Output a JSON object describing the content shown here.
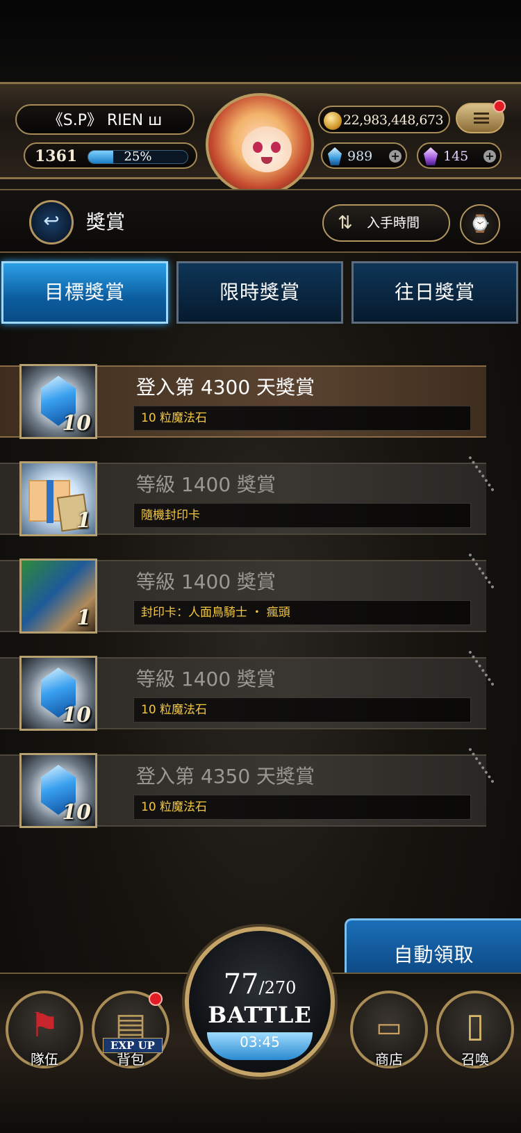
{
  "player": {
    "name": "《S.P》 RIEN ꟺ",
    "level": "1361",
    "exp_percent": "25%",
    "coins": "22,983,448,673",
    "blue_gems": "989",
    "purple_gems": "145"
  },
  "titlebar": {
    "title": "獎賞",
    "sort_label": "入手時間"
  },
  "tabs": [
    {
      "label": "目標獎賞",
      "active": true
    },
    {
      "label": "限時獎賞",
      "active": false
    },
    {
      "label": "往日獎賞",
      "active": false
    }
  ],
  "rewards": [
    {
      "title": "登入第 4300 天獎賞",
      "subtitle": "10 粒魔法石",
      "count": "10",
      "icon": "magic-stone-icon",
      "locked": false
    },
    {
      "title": "等級 1400 獎賞",
      "subtitle": "隨機封印卡",
      "count": "1",
      "icon": "gift-box-icon",
      "locked": true
    },
    {
      "title": "等級 1400 獎賞",
      "subtitle": "封印卡：人面鳥騎士 ・ 瘋頭",
      "count": "1",
      "icon": "card-portrait-icon",
      "locked": true
    },
    {
      "title": "等級 1400 獎賞",
      "subtitle": "10 粒魔法石",
      "count": "10",
      "icon": "magic-stone-icon",
      "locked": true
    },
    {
      "title": "登入第 4350 天獎賞",
      "subtitle": "10 粒魔法石",
      "count": "10",
      "icon": "magic-stone-icon",
      "locked": true
    }
  ],
  "auto_claim": "自動領取",
  "nav": {
    "team": "隊伍",
    "bag": "背包",
    "bag_badge": "EXP UP",
    "shop": "商店",
    "summon": "召喚"
  },
  "battle": {
    "stamina_current": "77",
    "stamina_max": "/270",
    "label": "BATTLE",
    "timer": "03:45"
  },
  "colors": {
    "accent_blue": "#2c9fe8",
    "gold_frame": "#b39560",
    "reward_subtitle": "#f5c842",
    "notification_red": "#e01d24"
  }
}
